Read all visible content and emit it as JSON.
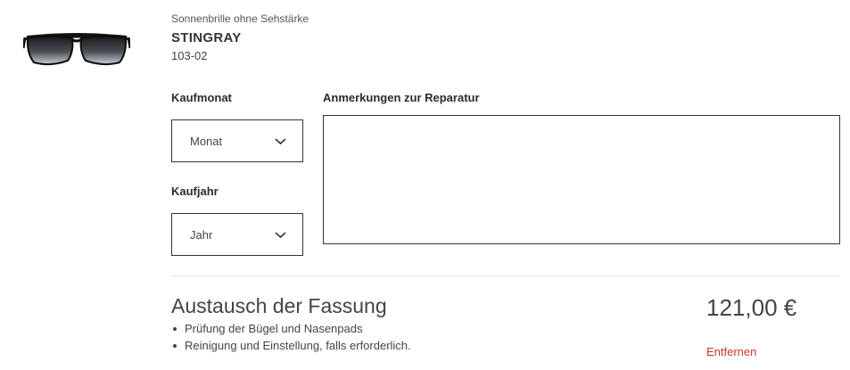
{
  "product": {
    "category": "Sonnenbrille ohne Sehstärke",
    "name": "STINGRAY",
    "code": "103-02",
    "image": "sunglasses-product-image"
  },
  "form": {
    "purchase_month": {
      "label": "Kaufmonat",
      "selected": "Monat"
    },
    "purchase_year": {
      "label": "Kaufjahr",
      "selected": "Jahr"
    },
    "repair_notes": {
      "label": "Anmerkungen zur Reparatur",
      "value": ""
    }
  },
  "service": {
    "title": "Austausch der Fassung",
    "items": [
      "Prüfung der Bügel und Nasenpads",
      "Reinigung und Einstellung, falls erforderlich."
    ],
    "price": "121,00 €",
    "remove_label": "Entfernen"
  },
  "colors": {
    "text": "#2b2b2b",
    "remove_link": "#c8342f",
    "divider": "#e3e3e3",
    "border": "#333333"
  },
  "icons": {
    "dropdown": "chevron-down-icon"
  }
}
